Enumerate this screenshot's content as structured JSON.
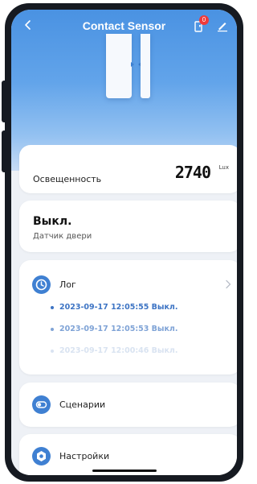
{
  "header": {
    "title": "Contact Sensor",
    "notification_count": "0",
    "icons": {
      "back": "back-chevron-icon",
      "device": "device-icon",
      "edit": "edit-pencil-icon"
    }
  },
  "illuminance": {
    "label": "Освещенность",
    "value": "2740",
    "unit": "Lux"
  },
  "status": {
    "state": "Выкл.",
    "device_name": "Датчик двери"
  },
  "log": {
    "title": "Лог",
    "entries": [
      "2023-09-17 12:05:55 Выкл.",
      "2023-09-17 12:05:53 Выкл.",
      "2023-09-17 12:00:46 Выкл."
    ]
  },
  "menu": {
    "scenarios": "Сценарии",
    "settings": "Настройки"
  },
  "colors": {
    "accent": "#3f80d2",
    "hero_top": "#4a92e2",
    "badge": "#ef3b3b"
  }
}
